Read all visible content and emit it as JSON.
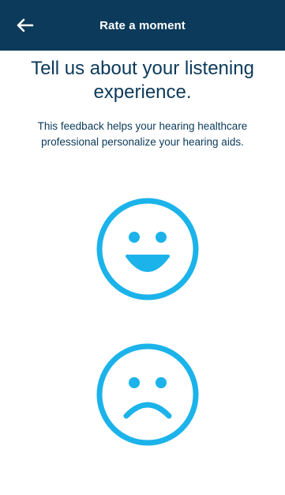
{
  "header": {
    "title": "Rate a moment",
    "back_icon": "arrow-left-icon",
    "background_color": "#0b3a5a"
  },
  "main": {
    "heading": "Tell us about your listening experience.",
    "description": "This feedback helps your hearing healthcare professional personalize your hearing aids."
  },
  "ratings": [
    {
      "icon": "happy-face-icon",
      "sentiment": "positive"
    },
    {
      "icon": "sad-face-icon",
      "sentiment": "negative"
    }
  ],
  "colors": {
    "accent": "#1bb3ea",
    "text": "#0b3a5a"
  }
}
